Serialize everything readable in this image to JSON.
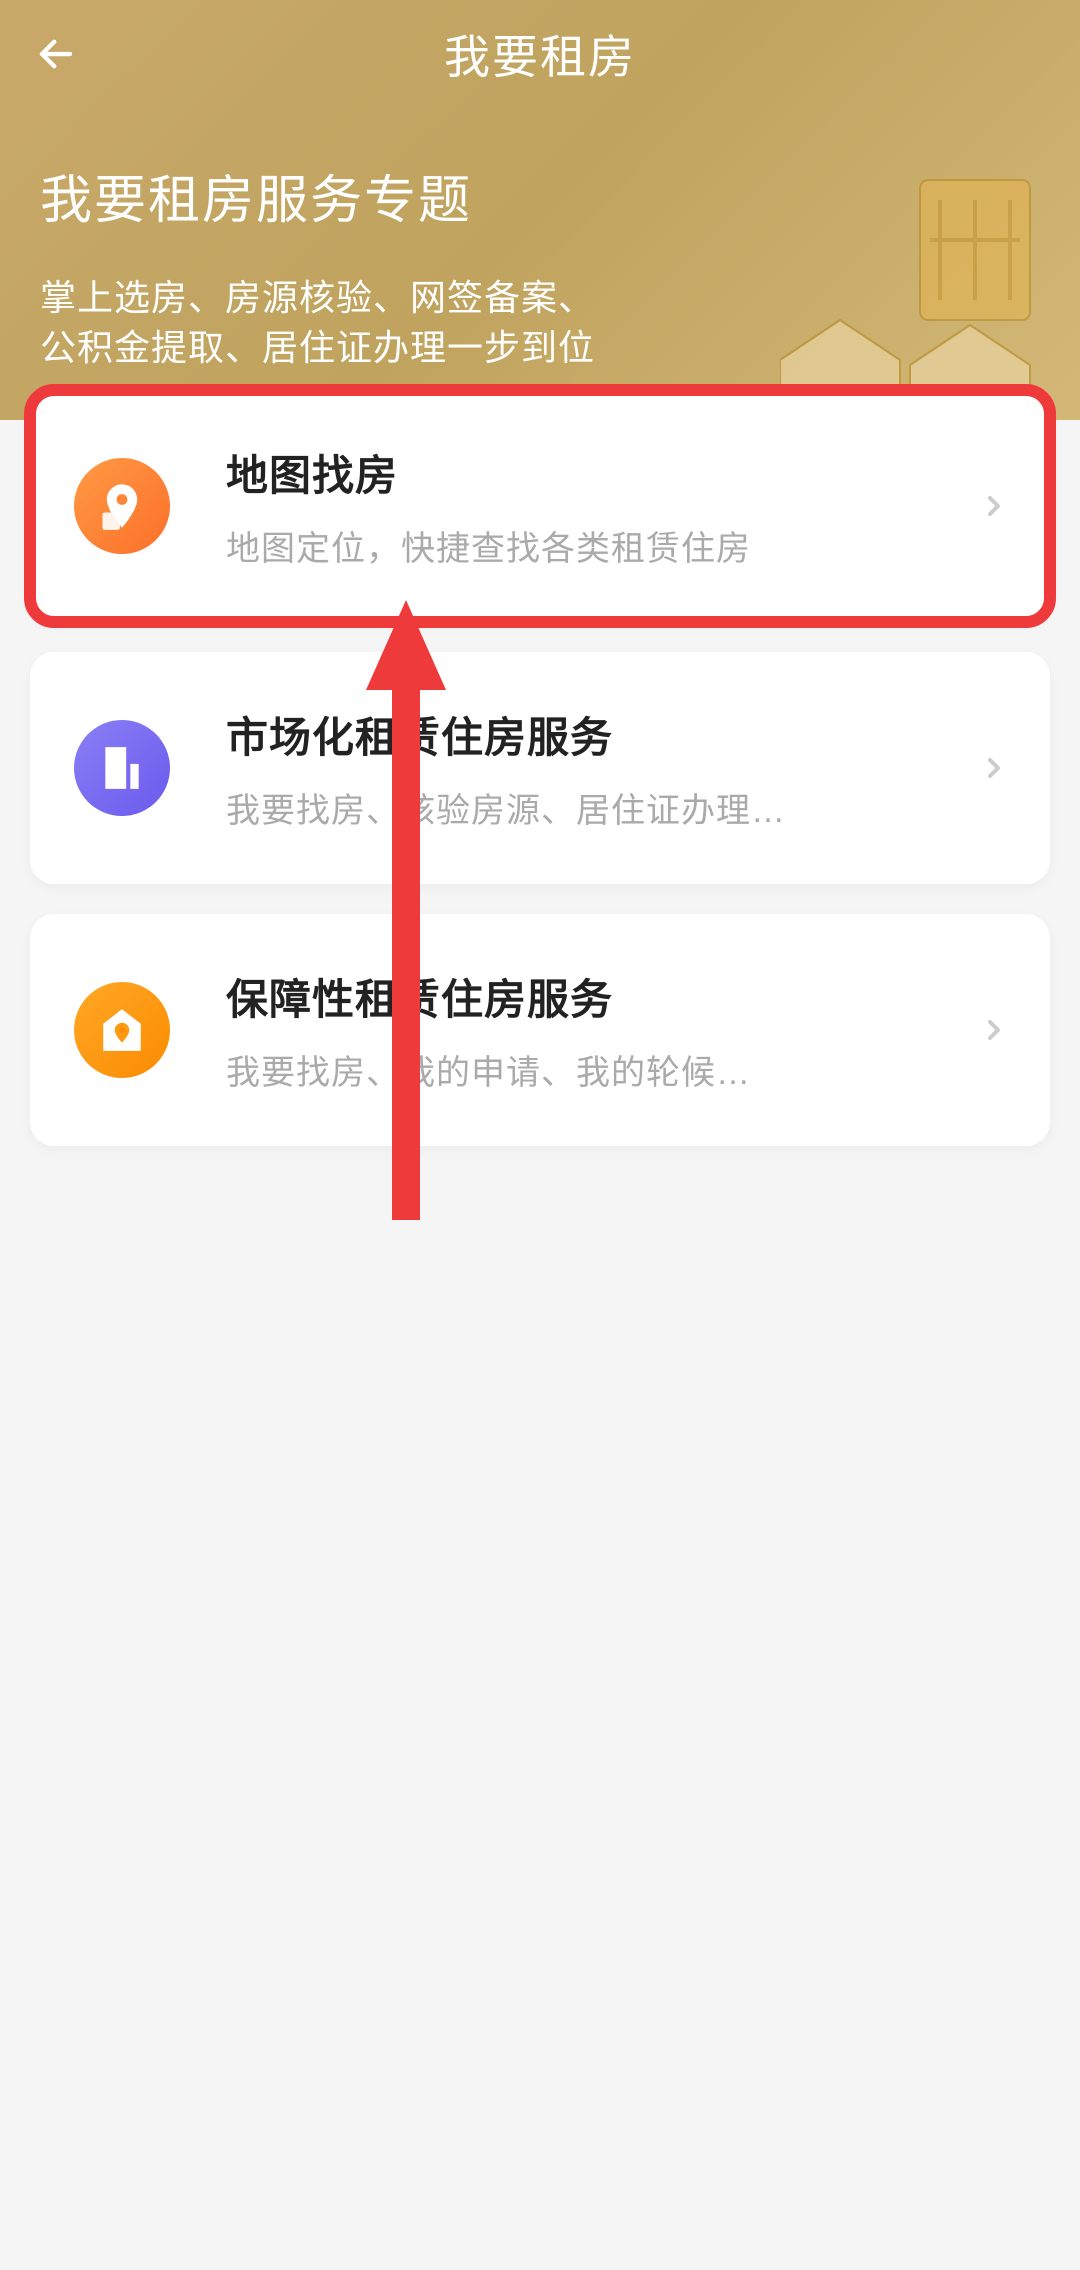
{
  "header": {
    "title": "我要租房"
  },
  "hero": {
    "title": "我要租房服务专题",
    "subtitle_line1": "掌上选房、房源核验、网签备案、",
    "subtitle_line2": "公积金提取、居住证办理一步到位"
  },
  "cards": [
    {
      "title": "地图找房",
      "desc": "地图定位，快捷查找各类租赁住房",
      "icon": "map-marker-icon",
      "color": "orange",
      "highlighted": true
    },
    {
      "title": "市场化租赁住房服务",
      "desc": "我要找房、核验房源、居住证办理…",
      "icon": "building-icon",
      "color": "purple",
      "highlighted": false
    },
    {
      "title": "保障性租赁住房服务",
      "desc": "我要找房、我的申请、我的轮候…",
      "icon": "house-shield-icon",
      "color": "amber",
      "highlighted": false
    }
  ],
  "annotation": {
    "type": "red-arrow-up",
    "target_card_index": 0
  }
}
